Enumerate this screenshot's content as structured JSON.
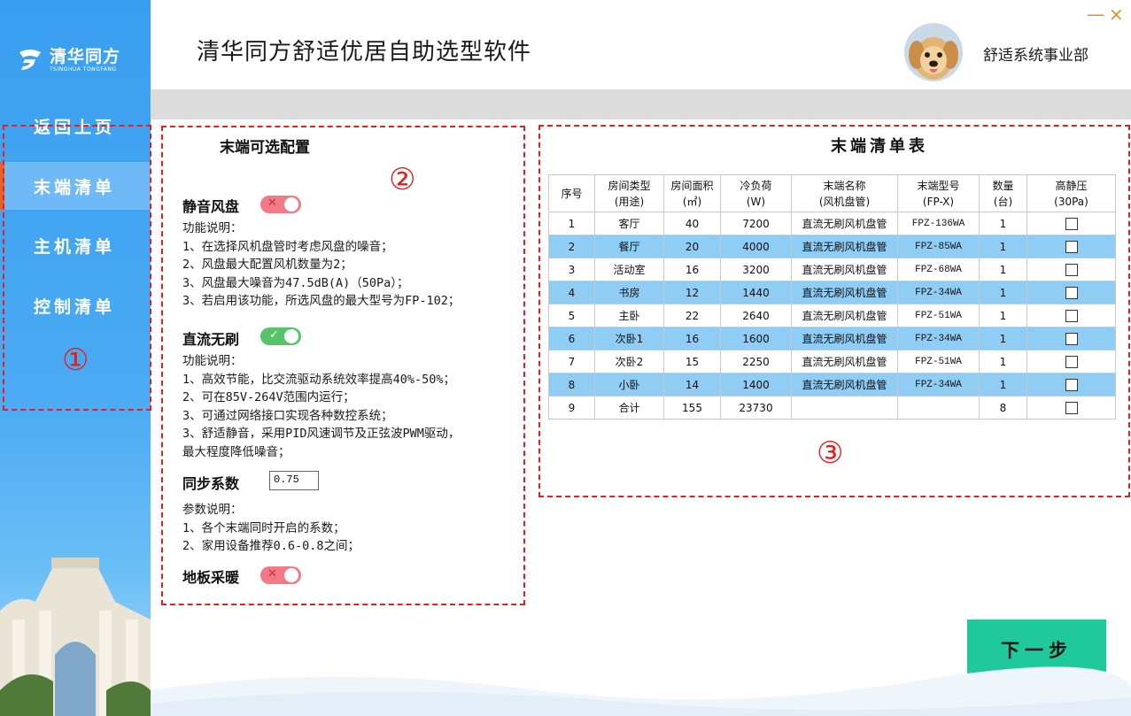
{
  "app": {
    "title": "清华同方舒适优居自助选型软件",
    "brand_cn": "清华同方",
    "brand_en": "TSINGHUA TONGFANG",
    "department": "舒适系统事业部",
    "minimize_glyph": "—",
    "close_glyph": "×"
  },
  "sidebar": {
    "items": [
      {
        "label": "返回上页"
      },
      {
        "label": "末端清单",
        "active": true
      },
      {
        "label": "主机清单"
      },
      {
        "label": "控制清单"
      }
    ],
    "marker": "①"
  },
  "config": {
    "title": "末端可选配置",
    "marker": "②",
    "options": [
      {
        "label": "静音风盘",
        "state": "off",
        "desc": "功能说明：\n1、在选择风机盘管时考虑风盘的噪音；\n2、风盘最大配置风机数量为2；\n3、风盘最大噪音为47.5dB(A)（50Pa）；\n3、若启用该功能，所选风盘的最大型号为FP-102；"
      },
      {
        "label": "直流无刷",
        "state": "on",
        "desc": "功能说明：\n1、高效节能，比交流驱动系统效率提高40%-50%；\n2、可在85V-264V范围内运行；\n3、可通过网络接口实现各种数控系统；\n3、舒适静音，采用PID风速调节及正弦波PWM驱动，\n最大程度降低噪音；"
      },
      {
        "label": "同步系数",
        "value": "0.75",
        "desc": "参数说明：\n1、各个末端同时开启的系数；\n2、家用设备推荐0.6-0.8之间；"
      },
      {
        "label": "地板采暖",
        "state": "off"
      }
    ],
    "off_mark": "✕",
    "on_mark": "✓"
  },
  "table": {
    "title": "末端清单表",
    "marker": "③",
    "headers": [
      {
        "l1": "序号",
        "l2": ""
      },
      {
        "l1": "房间类型",
        "l2": "(用途)"
      },
      {
        "l1": "房间面积",
        "l2": "(㎡)"
      },
      {
        "l1": "冷负荷",
        "l2": "(W)"
      },
      {
        "l1": "末端名称",
        "l2": "(风机盘管)"
      },
      {
        "l1": "末端型号",
        "l2": "(FP-X)"
      },
      {
        "l1": "数量",
        "l2": "(台)"
      },
      {
        "l1": "高静压",
        "l2": "(30Pa)"
      }
    ],
    "rows": [
      {
        "no": "1",
        "room": "客厅",
        "area": "40",
        "load": "7200",
        "name": "直流无刷风机盘管",
        "model": "FPZ-136WA",
        "qty": "1",
        "hl": false
      },
      {
        "no": "2",
        "room": "餐厅",
        "area": "20",
        "load": "4000",
        "name": "直流无刷风机盘管",
        "model": "FPZ-85WA",
        "qty": "1",
        "hl": true
      },
      {
        "no": "3",
        "room": "活动室",
        "area": "16",
        "load": "3200",
        "name": "直流无刷风机盘管",
        "model": "FPZ-68WA",
        "qty": "1",
        "hl": false
      },
      {
        "no": "4",
        "room": "书房",
        "area": "12",
        "load": "1440",
        "name": "直流无刷风机盘管",
        "model": "FPZ-34WA",
        "qty": "1",
        "hl": true
      },
      {
        "no": "5",
        "room": "主卧",
        "area": "22",
        "load": "2640",
        "name": "直流无刷风机盘管",
        "model": "FPZ-51WA",
        "qty": "1",
        "hl": false
      },
      {
        "no": "6",
        "room": "次卧1",
        "area": "16",
        "load": "1600",
        "name": "直流无刷风机盘管",
        "model": "FPZ-34WA",
        "qty": "1",
        "hl": true
      },
      {
        "no": "7",
        "room": "次卧2",
        "area": "15",
        "load": "2250",
        "name": "直流无刷风机盘管",
        "model": "FPZ-51WA",
        "qty": "1",
        "hl": false
      },
      {
        "no": "8",
        "room": "小卧",
        "area": "14",
        "load": "1400",
        "name": "直流无刷风机盘管",
        "model": "FPZ-34WA",
        "qty": "1",
        "hl": true
      },
      {
        "no": "9",
        "room": "合计",
        "area": "155",
        "load": "23730",
        "name": "",
        "model": "",
        "qty": "8",
        "hl": false
      }
    ]
  },
  "next_button": {
    "label": "下一步"
  },
  "colors": {
    "accent": "#20c99b",
    "sidebar": "#3a9ff0",
    "highlight_row": "#8fcdf5",
    "annotation": "#e81d1d",
    "window_controls": "#f08a24"
  }
}
